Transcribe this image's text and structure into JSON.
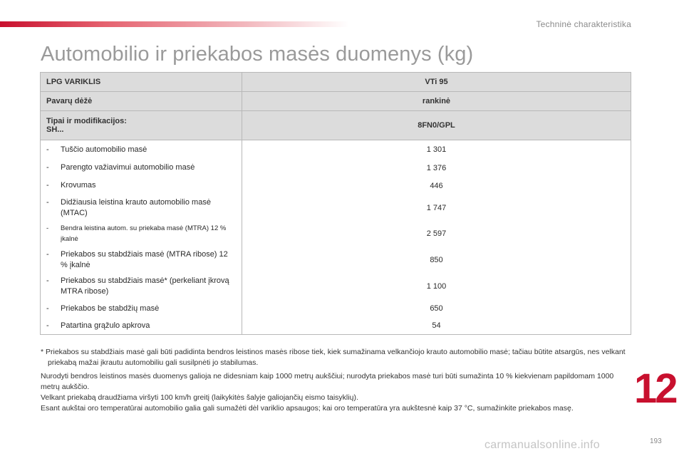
{
  "header": {
    "section_title": "Techninė charakteristika",
    "page_title": "Automobilio ir priekabos masės duomenys (kg)"
  },
  "table": {
    "head_rows": [
      {
        "label": "LPG VARIKLIS",
        "value": "VTi 95"
      },
      {
        "label": "Pavarų dėžė",
        "value": "rankinė"
      },
      {
        "label": "Tipai ir modifikacijos: SH...",
        "label_line1": "Tipai ir modifikacijos:",
        "label_line2": "SH...",
        "value": "8FN0/GPL"
      }
    ],
    "rows": [
      {
        "dash": "-",
        "label": "Tuščio automobilio masė",
        "value": "1 301"
      },
      {
        "dash": "-",
        "label": "Parengto važiavimui automobilio masė",
        "value": "1 376"
      },
      {
        "dash": "-",
        "label": "Krovumas",
        "value": "446"
      },
      {
        "dash": "-",
        "label": "Didžiausia leistina krauto automobilio masė (MTAC)",
        "value": "1 747"
      },
      {
        "dash": "-",
        "label": "Bendra leistina autom. su priekaba masė (MTRA) 12 % įkalnė",
        "value": "2 597"
      },
      {
        "dash": "-",
        "label": "Priekabos su stabdžiais masė (MTRA ribose) 12 % įkalnė",
        "value": "850"
      },
      {
        "dash": "-",
        "label": "Priekabos su stabdžiais masė* (perkeliant įkrovą MTRA ribose)",
        "value": "1 100"
      },
      {
        "dash": "-",
        "label": "Priekabos be stabdžių masė",
        "value": "650"
      },
      {
        "dash": "-",
        "label": "Patartina grąžulo apkrova",
        "value": "54"
      }
    ]
  },
  "footnote": "* Priekabos su stabdžiais masė gali būti padidinta bendros leistinos masės ribose tiek, kiek sumažinama velkančiojo krauto automobilio masė; tačiau būtite atsargūs, nes velkant priekabą mažai įkrautu automobiliu gali susilpnėti jo stabilumas.",
  "notes": [
    "Nurodyti bendros leistinos masės duomenys galioja ne didesniam kaip 1000 metrų aukščiui; nurodyta priekabos masė turi būti sumažinta 10 % kiekvienam papildomam 1000 metrų aukščio.",
    "Velkant priekabą draudžiama viršyti 100 km/h greitį (laikykitės šalyje galiojančių eismo taisyklių).",
    "Esant aukštai oro temperatūrai automobilio galia gali sumažėti dėl variklio apsaugos; kai oro temperatūra yra aukštesnė kaip 37 °C, sumažinkite priekabos masę."
  ],
  "chapter_number": "12",
  "page_number": "193",
  "watermark": "carmanualsonline.info",
  "colors": {
    "accent": "#c8102e",
    "header_bg": "#dcdcdc",
    "title_gray": "#9a9a9a"
  }
}
